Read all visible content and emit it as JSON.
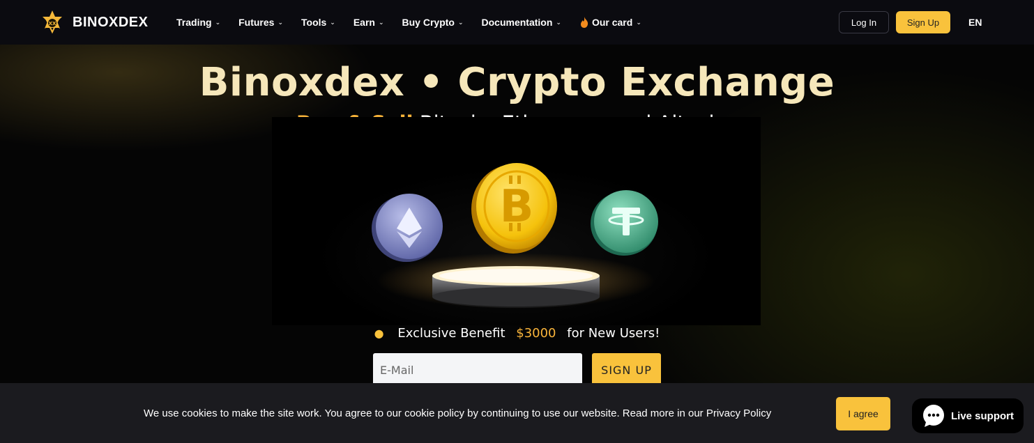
{
  "brand": {
    "name": "BINOXDEX"
  },
  "nav": {
    "items": [
      {
        "label": "Trading"
      },
      {
        "label": "Futures"
      },
      {
        "label": "Tools"
      },
      {
        "label": "Earn"
      },
      {
        "label": "Buy Crypto"
      },
      {
        "label": "Documentation"
      },
      {
        "label": "Our card",
        "icon": "fire-icon"
      }
    ],
    "login_label": "Log In",
    "signup_label": "Sign Up",
    "language": "EN"
  },
  "hero": {
    "title": "Binoxdex • Crypto Exchange",
    "subtitle_accent": "Buy & Sell",
    "subtitle_rest": "Bitcoin, Ethereum, and Altcoins",
    "coins": [
      "ethereum-coin-icon",
      "bitcoin-coin-icon",
      "tether-coin-icon"
    ],
    "benefit_prefix": "Exclusive Benefit",
    "benefit_amount": "$3000",
    "benefit_suffix": "for New Users!",
    "email_placeholder": "E-Mail",
    "signup_button": "SIGN UP"
  },
  "cookie": {
    "text": "We use cookies to make the site work. You agree to our cookie policy by continuing to use our website. Read more in our Privacy Policy",
    "agree_label": "I agree"
  },
  "support": {
    "label": "Live support"
  },
  "colors": {
    "accent": "#f9c23c",
    "title_gold": "#f6e7ba",
    "navbar_bg": "#0b0b10",
    "cookie_bg": "#1b1b1f"
  }
}
